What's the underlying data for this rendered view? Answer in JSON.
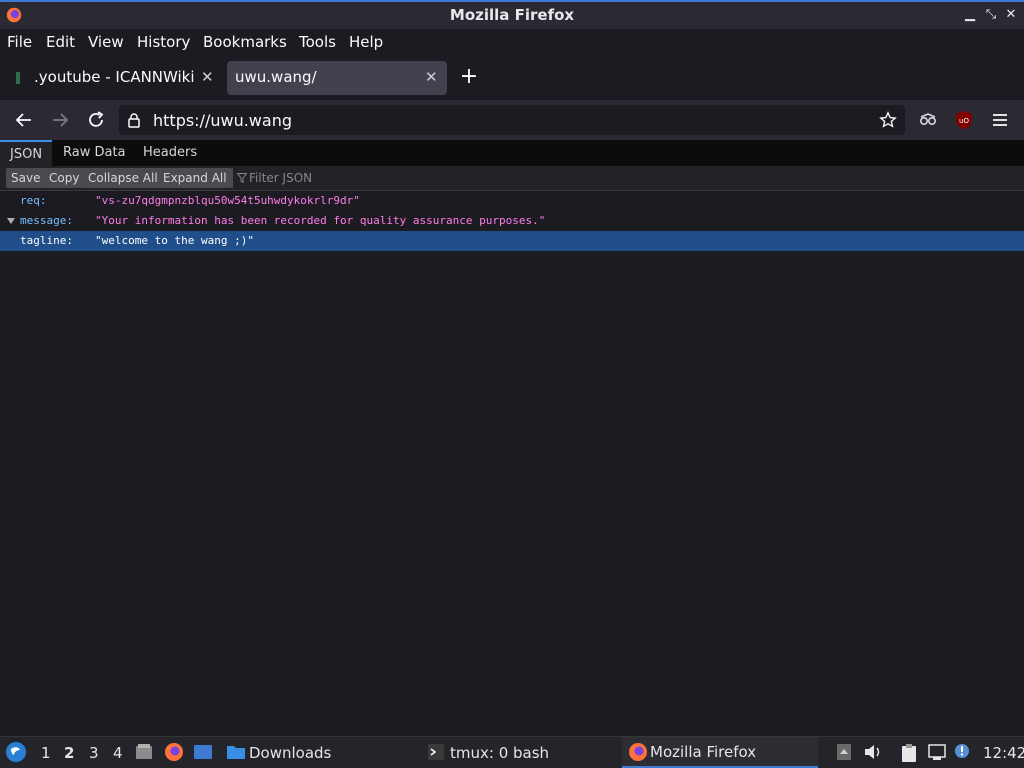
{
  "window": {
    "title": "Mozilla Firefox"
  },
  "menubar": [
    "File",
    "Edit",
    "View",
    "History",
    "Bookmarks",
    "Tools",
    "Help"
  ],
  "tabs": [
    {
      "title": ".youtube - ICANNWiki"
    },
    {
      "title": "uwu.wang/"
    }
  ],
  "urlbar": {
    "url": "https://uwu.wang"
  },
  "json_viewer": {
    "tabs": [
      "JSON",
      "Raw Data",
      "Headers"
    ],
    "toolbar": [
      "Save",
      "Copy",
      "Collapse All",
      "Expand All"
    ],
    "filter_placeholder": "Filter JSON",
    "rows": [
      {
        "key": "req:",
        "value": "\"vs-zu7qdgmpnzblqu50w54t5uhwdykokrlr9dr\""
      },
      {
        "key": "message:",
        "value": "\"Your information has been recorded for quality assurance purposes.\""
      },
      {
        "key": "tagline:",
        "value": "\"welcome to the wang ;)\""
      }
    ]
  },
  "taskbar": {
    "workspaces": [
      "1",
      "2",
      "3",
      "4"
    ],
    "apps": [
      "Downloads",
      "tmux: 0 bash",
      "Mozilla Firefox"
    ],
    "clock": "12:42"
  }
}
